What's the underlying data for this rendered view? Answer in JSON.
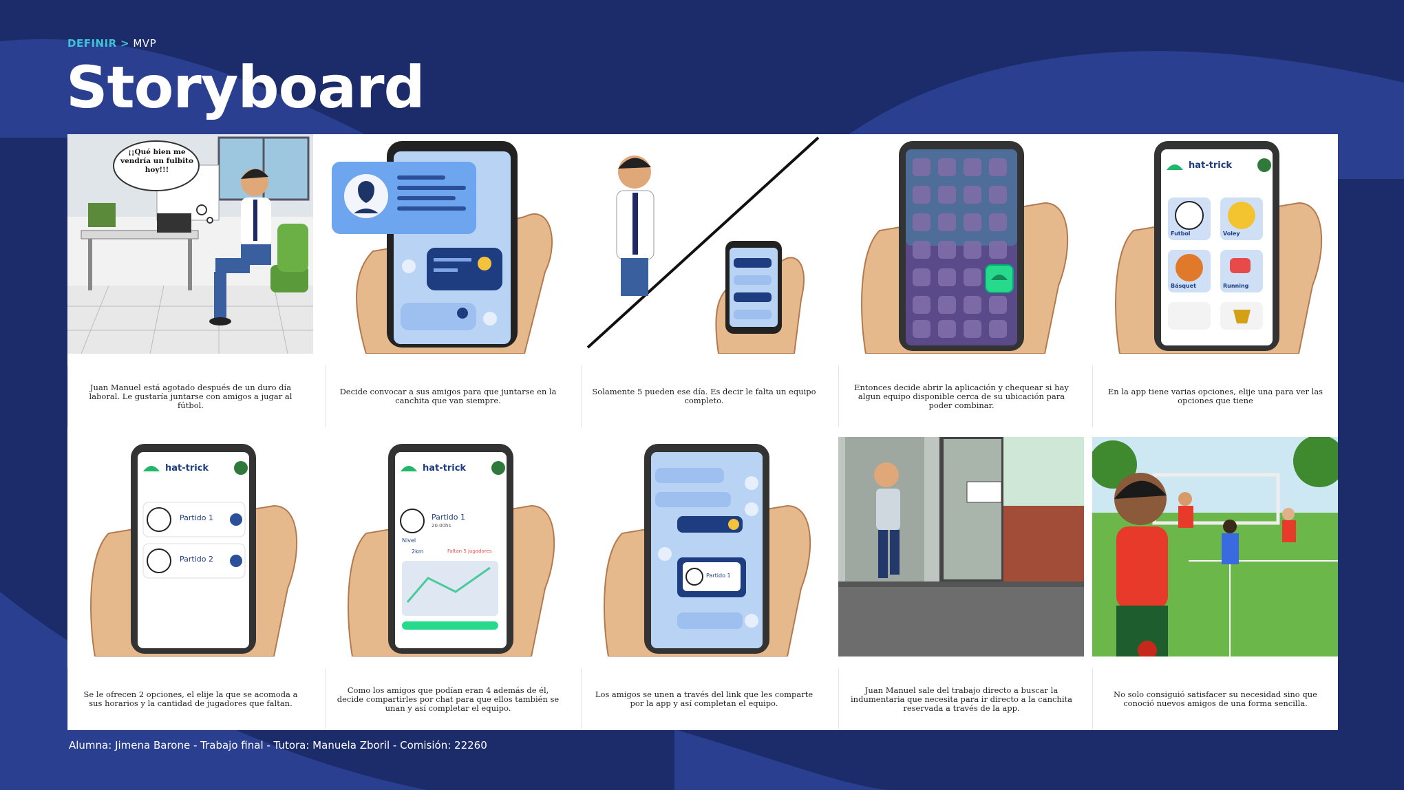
{
  "breadcrumb": {
    "section": "DEFINIR",
    "separator": ">",
    "page": "MVP"
  },
  "title": "Storyboard",
  "app_name": "hat-trick",
  "panels": [
    {
      "bubble": "¡¡Qué bien me vendría un fulbito hoy!!!",
      "caption": "Juan Manuel está agotado después de un duro día laboral.  Le gustaría juntarse con amigos a jugar al fútbol."
    },
    {
      "caption": "Decide convocar a sus amigos para que juntarse en la canchita que van siempre."
    },
    {
      "caption": "Solamente 5 pueden ese día. Es decir le falta un equipo completo."
    },
    {
      "caption": "Entonces decide abrir la aplicación y chequear si hay algun equipo disponible cerca de su ubicación para poder combinar."
    },
    {
      "caption": "En la app tiene varias opciones, elije una para ver las opciones que tiene",
      "options": [
        "Futbol",
        "Voley",
        "Básquet",
        "Running"
      ]
    },
    {
      "caption": "Se le ofrecen 2 opciones, el elije la que se acomoda a sus horarios y la cantidad de jugadores que faltan.",
      "matches": [
        "Partido 1",
        "Partido 2"
      ]
    },
    {
      "caption": "Como los amigos que podían eran 4 además de él, decide compartirles por chat para que ellos también se unan y así completar el equipo.",
      "match": "Partido 1",
      "time": "20.00hs",
      "level": "Nivel",
      "distance": "2km",
      "missing": "Faltan 5 jugadores"
    },
    {
      "caption": "Los amigos se unen a través del link que les comparte por la app y así completan el equipo.",
      "match": "Partido 1"
    },
    {
      "caption": "Juan Manuel sale del trabajo directo a buscar la indumentaria que necesita para ir directo a la canchita reservada a través de la app."
    },
    {
      "caption": "No solo consiguió satisfacer su necesidad sino que conoció nuevos amigos de una forma sencilla."
    }
  ],
  "footer": "Alumna: Jimena Barone - Trabajo final - Tutora: Manuela Zboril - Comisión: 22260"
}
